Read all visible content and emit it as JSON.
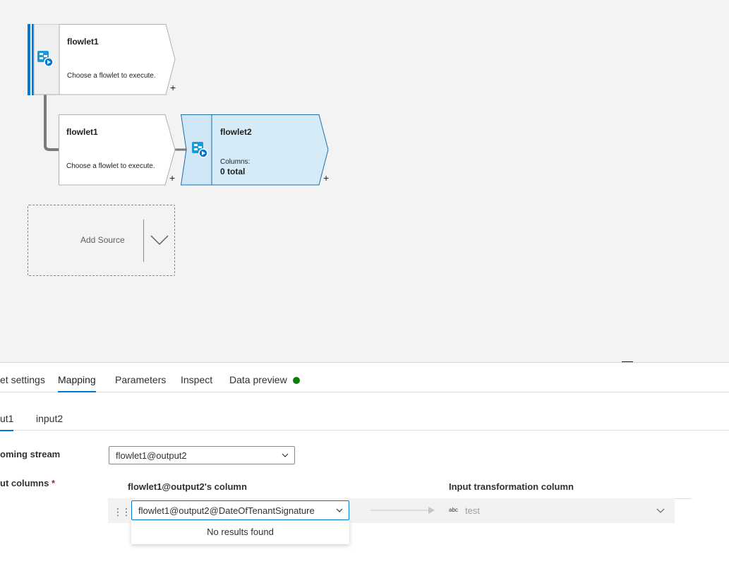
{
  "canvas": {
    "nodes": [
      {
        "title": "flowlet1",
        "description": "Choose a flowlet to execute.",
        "plus": "+"
      },
      {
        "title": "flowlet1",
        "description": "Choose a flowlet to execute.",
        "plus": "+"
      },
      {
        "title": "flowlet2",
        "columns_label": "Columns:",
        "columns_value": "0 total",
        "plus": "+"
      }
    ],
    "add_source": {
      "label": "Add Source"
    },
    "icons": {
      "flowlet": "flowlet-icon",
      "chevron": "chevron-down-icon"
    },
    "colors": {
      "selected_bar": "#0078d4",
      "selected_fill": "#d6ebf8",
      "selected_border": "#1e6ea8",
      "connector": "#7a7a7a"
    }
  },
  "panel": {
    "tabs": [
      {
        "label": "et settings"
      },
      {
        "label": "Mapping",
        "active": true
      },
      {
        "label": "Parameters"
      },
      {
        "label": "Inspect"
      },
      {
        "label": "Data preview"
      }
    ],
    "data_preview_status_color": "#107c10",
    "subtabs": [
      {
        "label": "ut1",
        "active": true
      },
      {
        "label": "input2"
      }
    ],
    "incoming_stream": {
      "label": "oming stream",
      "value": "flowlet1@output2"
    },
    "input_columns": {
      "label": "ut columns",
      "required_mark": "*"
    },
    "mapping": {
      "source_header": "flowlet1@output2's column",
      "target_header": "Input transformation column",
      "rows": [
        {
          "source_value": "flowlet1@output2@DateOfTenantSignature",
          "target_type": "abc",
          "target_value": "test"
        }
      ],
      "dropdown_message": "No results found"
    }
  }
}
